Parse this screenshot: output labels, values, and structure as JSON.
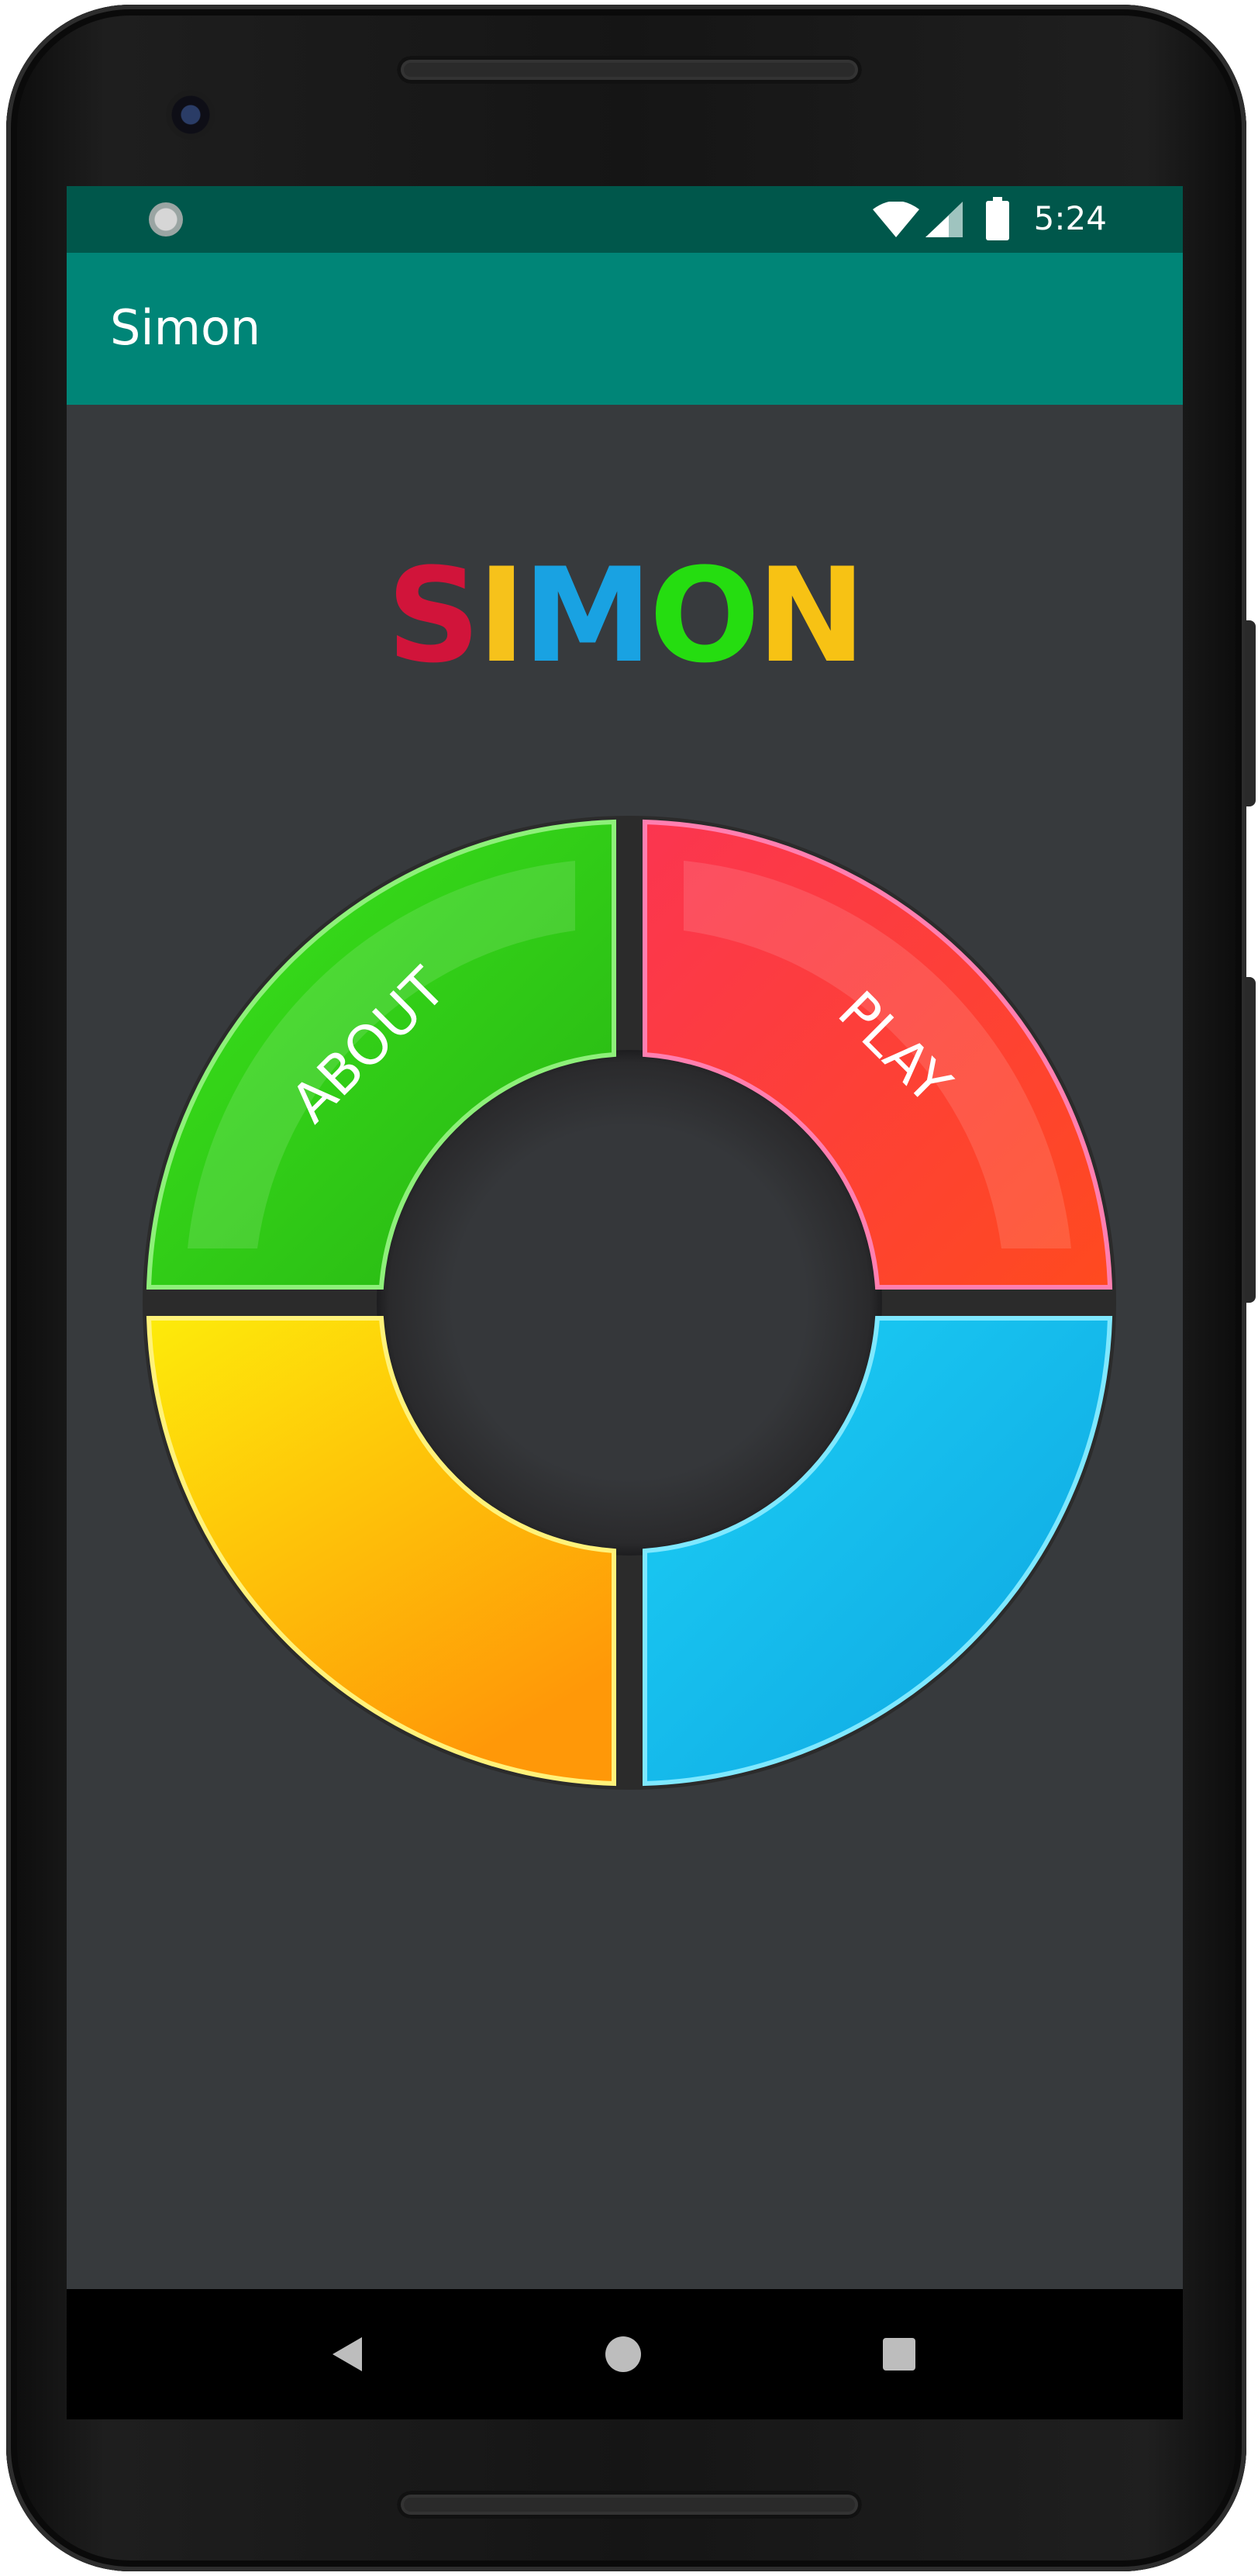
{
  "status_bar": {
    "time": "5:24",
    "icons": [
      "sync-icon",
      "wifi-icon",
      "cell-signal-icon",
      "battery-icon"
    ]
  },
  "app_bar": {
    "title": "Simon"
  },
  "logo": {
    "letters": [
      {
        "char": "S",
        "color": "#d1143a"
      },
      {
        "char": "I",
        "color": "#f6c21b"
      },
      {
        "char": "M",
        "color": "#19a2e2"
      },
      {
        "char": "O",
        "color": "#25dd10"
      },
      {
        "char": "N",
        "color": "#f7c214"
      }
    ]
  },
  "board": {
    "about_label": "ABOUT",
    "play_label": "PLAY",
    "colors": {
      "green": "#33d418",
      "red": "#fb3a3a",
      "yellow": "#fdd80a",
      "blue": "#13bdf0"
    }
  },
  "nav_bar": {
    "icons": [
      "back-icon",
      "home-icon",
      "recents-icon"
    ]
  }
}
